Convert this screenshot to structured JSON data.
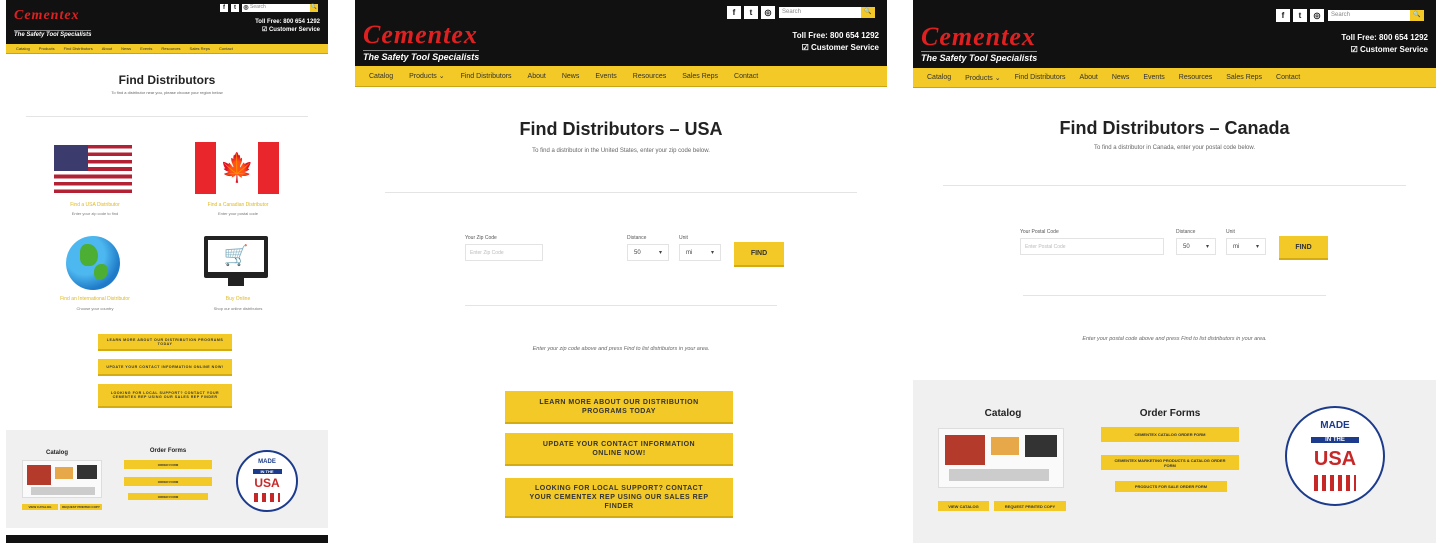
{
  "brand": {
    "logo": "Cementex",
    "tagline": "The Safety Tool Specialists"
  },
  "header": {
    "toll_free": "Toll Free: 800 654 1292",
    "toll_free_short": "Toll Free: 800 654 1292",
    "customer_service": "☑ Customer Service",
    "search_placeholder": "Search",
    "search_btn": "🔍",
    "social": [
      "f",
      "t",
      "◎"
    ]
  },
  "nav": {
    "panel1": [
      "Catalog",
      "Products",
      "Find Distributors",
      "About",
      "News",
      "Events",
      "Resources",
      "Sales Reps",
      "Contact"
    ],
    "panel2": [
      "Catalog",
      "Products ⌄",
      "Find Distributors",
      "About",
      "News",
      "Events",
      "Resources",
      "Sales Reps",
      "Contact"
    ],
    "panel3": [
      "Catalog",
      "Products ⌄",
      "Find Distributors",
      "About",
      "News",
      "Events",
      "Resources",
      "Sales Reps",
      "Contact"
    ]
  },
  "panel1": {
    "title": "Find Distributors",
    "subtitle": "To find a distributor near you, please choose your region below",
    "rule_text": "",
    "usa_label": "Find a USA Distributor",
    "usa_sub": "Enter your zip code to find",
    "canada_label": "Find a Canadian Distributor",
    "canada_sub": "Enter your postal code",
    "intl_label": "Find an International Distributor",
    "intl_sub": "Choose your country",
    "online_label": "Buy Online",
    "online_sub": "Shop our online distributors",
    "cta": [
      "Learn more about our distribution programs today",
      "Update your contact information online now!",
      "Looking for local support? Contact your Cementex rep using our sales rep finder"
    ],
    "catalog_title": "Catalog",
    "order_title": "Order Forms",
    "order_btns": [
      "Order Form",
      "Order Form",
      "Order Form"
    ],
    "catalog_btns": [
      "View Catalog",
      "Request Printed Copy"
    ],
    "seal_made": "MADE",
    "seal_inthe": "IN THE",
    "seal_usa": "USA"
  },
  "panel2": {
    "title": "Find Distributors – USA",
    "subtitle": "To find a distributor in the United States, enter your zip code below.",
    "zip_label": "Your Zip Code",
    "zip_placeholder": "Enter Zip Code",
    "distance_label": "Distance",
    "distance_value": "50",
    "unit_label": "Unit",
    "unit_value": "mi",
    "find_btn": "FIND",
    "note": "Enter your zip code above and press Find to list distributors in your area.",
    "cta": [
      "Learn more about our distribution programs today",
      "Update your contact information online now!",
      "Looking for local support? Contact your Cementex rep using our sales rep finder"
    ]
  },
  "panel3": {
    "title": "Find Distributors – Canada",
    "subtitle": "To find a distributor in Canada, enter your postal code below.",
    "zip_label": "Your Postal Code",
    "zip_placeholder": "Enter Postal Code",
    "distance_label": "Distance",
    "distance_value": "50",
    "unit_label": "Unit",
    "unit_value": "mi",
    "find_btn": "FIND",
    "note": "Enter your postal code above and press Find to list distributors in your area.",
    "catalog_title": "Catalog",
    "order_title": "Order Forms",
    "order_btns": [
      "Cementex Catalog Order Form",
      "Cementex Marketing Products & Catalog Order Form",
      "Products for Sale Order Form"
    ],
    "catalog_btns": [
      "View Catalog",
      "Request Printed Copy"
    ],
    "seal_made": "MADE",
    "seal_inthe": "IN THE",
    "seal_usa": "USA"
  },
  "colors": {
    "brand_red": "#e02020",
    "accent_yellow": "#f2c926",
    "header_black": "#111111",
    "seal_blue": "#1c3b8c"
  }
}
